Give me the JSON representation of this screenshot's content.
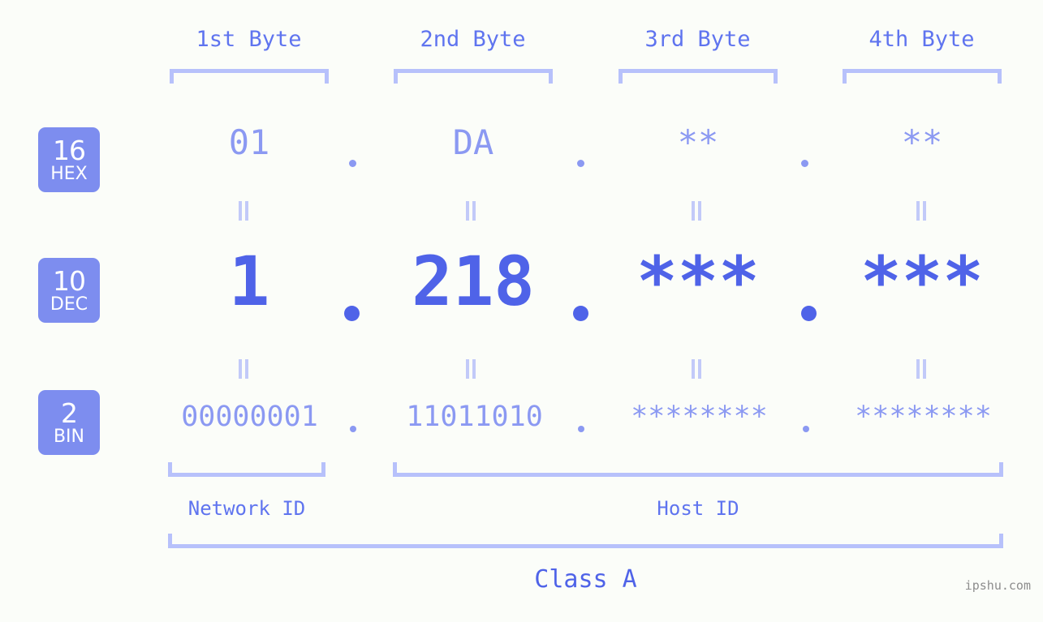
{
  "background_color": "#fbfdf9",
  "accent_colors": {
    "bracket": "#b7c1fb",
    "badge_bg": "#7d8def",
    "light_value": "#8b99f2",
    "strong_value": "#4f63e8",
    "header_label": "#5f74ef",
    "equals_mark": "#c2caf9",
    "watermark": "#8d8d8d"
  },
  "headers": [
    {
      "label": "1st Byte"
    },
    {
      "label": "2nd Byte"
    },
    {
      "label": "3rd Byte"
    },
    {
      "label": "4th Byte"
    }
  ],
  "radix_badges": [
    {
      "number": "16",
      "unit": "HEX"
    },
    {
      "number": "10",
      "unit": "DEC"
    },
    {
      "number": "2",
      "unit": "BIN"
    }
  ],
  "rows": {
    "hex": {
      "radix_number": "16",
      "radix_unit": "HEX",
      "values": [
        "01",
        "DA",
        "**",
        "**"
      ],
      "separator": "."
    },
    "dec": {
      "radix_number": "10",
      "radix_unit": "DEC",
      "values": [
        "1",
        "218",
        "***",
        "***"
      ],
      "separator": "."
    },
    "bin": {
      "radix_number": "2",
      "radix_unit": "BIN",
      "values": [
        "00000001",
        "11011010",
        "********",
        "********"
      ],
      "separator": "."
    }
  },
  "equals_marks": {
    "symbol": "||",
    "count_per_gap": 4
  },
  "segments": {
    "network_id": "Network ID",
    "host_id": "Host ID",
    "class": "Class A"
  },
  "watermark": "ipshu.com"
}
